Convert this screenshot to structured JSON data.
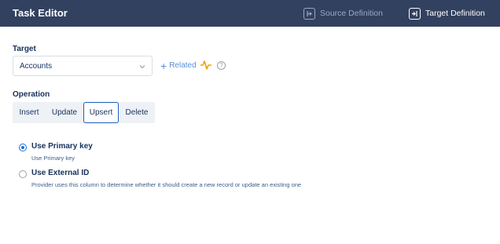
{
  "header": {
    "title": "Task Editor",
    "source_label": "Source Definition",
    "target_label": "Target Definition"
  },
  "target": {
    "label": "Target",
    "selected": "Accounts",
    "related_label": "Related"
  },
  "operation": {
    "label": "Operation",
    "options": [
      "Insert",
      "Update",
      "Upsert",
      "Delete"
    ],
    "selected": "Upsert"
  },
  "keys": [
    {
      "title": "Use Primary key",
      "description": "Use Primary key",
      "checked": true
    },
    {
      "title": "Use External ID",
      "description": "Provider uses this column to determine whether it should create a new record or update an existing one",
      "checked": false
    }
  ],
  "colors": {
    "header_bg": "#32415f",
    "accent": "#1b6ed8",
    "pulse": "#f2a007",
    "link": "#5b8fd6"
  }
}
